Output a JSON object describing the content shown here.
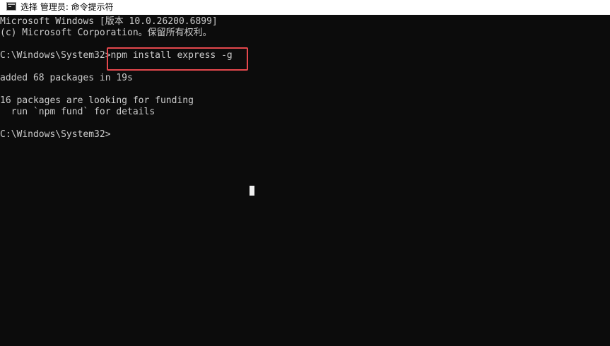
{
  "window": {
    "title": "选择 管理员: 命令提示符",
    "icon": "console-app-icon"
  },
  "console": {
    "lines": [
      "Microsoft Windows [版本 10.0.26200.6899]",
      "(c) Microsoft Corporation。保留所有权利。",
      "",
      "C:\\Windows\\System32>npm install express -g",
      "",
      "added 68 packages in 19s",
      "",
      "16 packages are looking for funding",
      "  run `npm fund` for details",
      "",
      "C:\\Windows\\System32>"
    ],
    "colors": {
      "background": "#0c0c0c",
      "text": "#cccccc",
      "highlight": "#e5484d"
    }
  }
}
